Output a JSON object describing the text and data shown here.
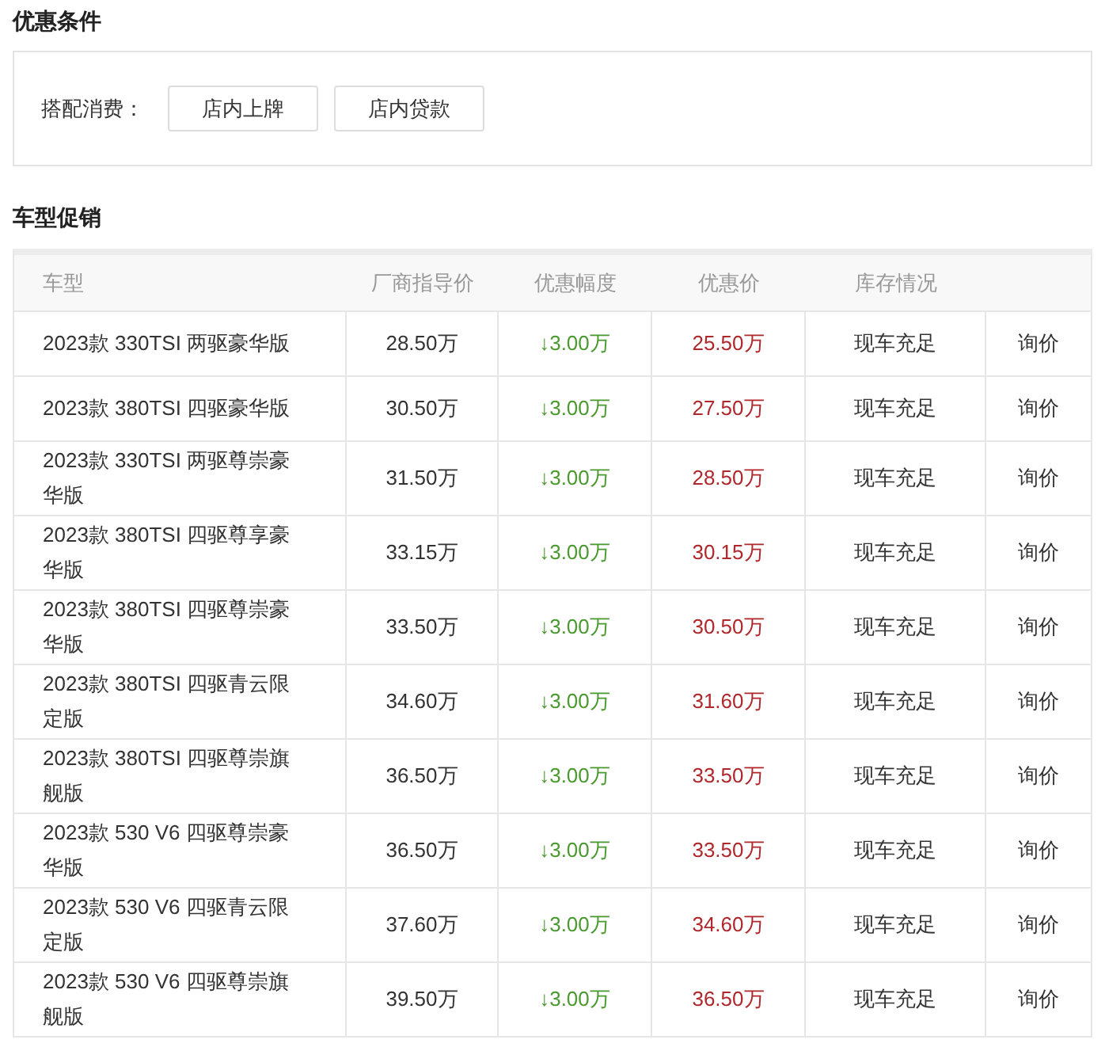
{
  "conditions": {
    "title": "优惠条件",
    "label": "搭配消费：",
    "buttons": [
      "店内上牌",
      "店内贷款"
    ]
  },
  "promotions": {
    "title": "车型促销",
    "columns": [
      "车型",
      "厂商指导价",
      "优惠幅度",
      "优惠价",
      "库存情况"
    ],
    "rows": [
      {
        "model": "2023款 330TSI 两驱豪华版",
        "msrp": "28.50万",
        "discount": "↓3.00万",
        "price": "25.50万",
        "stock": "现车充足",
        "action": "询价"
      },
      {
        "model": "2023款 380TSI 四驱豪华版",
        "msrp": "30.50万",
        "discount": "↓3.00万",
        "price": "27.50万",
        "stock": "现车充足",
        "action": "询价"
      },
      {
        "model": "2023款 330TSI 两驱尊崇豪华版",
        "msrp": "31.50万",
        "discount": "↓3.00万",
        "price": "28.50万",
        "stock": "现车充足",
        "action": "询价"
      },
      {
        "model": "2023款 380TSI 四驱尊享豪华版",
        "msrp": "33.15万",
        "discount": "↓3.00万",
        "price": "30.15万",
        "stock": "现车充足",
        "action": "询价"
      },
      {
        "model": "2023款 380TSI 四驱尊崇豪华版",
        "msrp": "33.50万",
        "discount": "↓3.00万",
        "price": "30.50万",
        "stock": "现车充足",
        "action": "询价"
      },
      {
        "model": "2023款 380TSI 四驱青云限定版",
        "msrp": "34.60万",
        "discount": "↓3.00万",
        "price": "31.60万",
        "stock": "现车充足",
        "action": "询价"
      },
      {
        "model": "2023款 380TSI 四驱尊崇旗舰版",
        "msrp": "36.50万",
        "discount": "↓3.00万",
        "price": "33.50万",
        "stock": "现车充足",
        "action": "询价"
      },
      {
        "model": "2023款 530 V6 四驱尊崇豪华版",
        "msrp": "36.50万",
        "discount": "↓3.00万",
        "price": "33.50万",
        "stock": "现车充足",
        "action": "询价"
      },
      {
        "model": "2023款 530 V6 四驱青云限定版",
        "msrp": "37.60万",
        "discount": "↓3.00万",
        "price": "34.60万",
        "stock": "现车充足",
        "action": "询价"
      },
      {
        "model": "2023款 530 V6 四驱尊崇旗舰版",
        "msrp": "39.50万",
        "discount": "↓3.00万",
        "price": "36.50万",
        "stock": "现车充足",
        "action": "询价"
      }
    ]
  }
}
